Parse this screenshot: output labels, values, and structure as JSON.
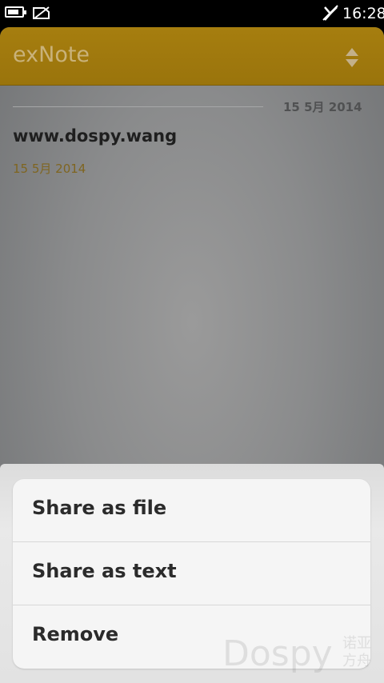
{
  "status_bar": {
    "time": "16:28",
    "icons": [
      "battery-icon",
      "no-sim-icon",
      "signal-off-icon"
    ]
  },
  "app": {
    "title": "exNote",
    "sort_icon": "sort-icon",
    "accent_color": "#a67e0f"
  },
  "notes_list": {
    "section_date": "15 5月 2014",
    "items": [
      {
        "title": "www.dospy.wang",
        "date": "15 5月 2014"
      }
    ]
  },
  "context_menu": {
    "items": [
      {
        "label": "Share as file"
      },
      {
        "label": "Share as text"
      },
      {
        "label": "Remove"
      }
    ]
  },
  "watermark": {
    "text": "Dospy",
    "cn": "诺亚方舟"
  }
}
